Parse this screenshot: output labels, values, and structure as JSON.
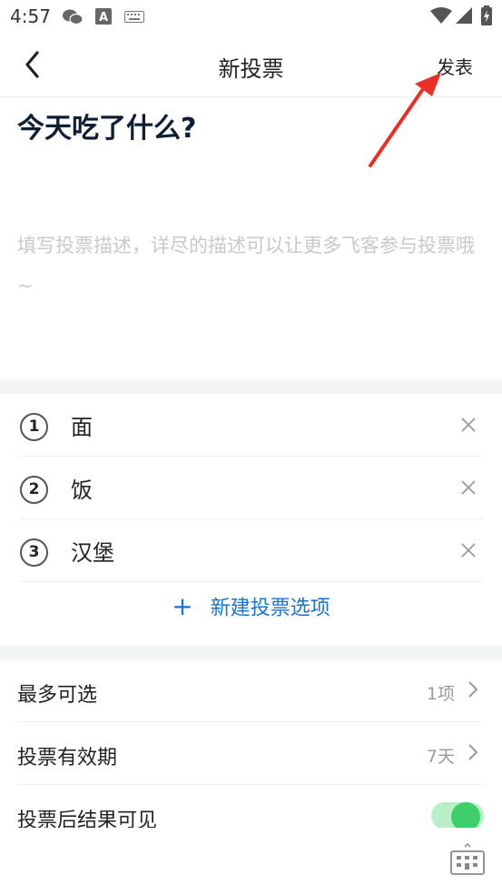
{
  "status_bar": {
    "time": "4:57",
    "icons": [
      "wechat-icon",
      "text-a-icon",
      "keyboard-icon",
      "wifi-icon",
      "signal-icon",
      "battery-icon"
    ]
  },
  "nav": {
    "title": "新投票",
    "publish_label": "发表",
    "back_icon": "chevron-left-icon"
  },
  "vote": {
    "title": "今天吃了什么?",
    "description_placeholder": "填写投票描述，详尽的描述可以让更多飞客参与投票哦~"
  },
  "options": [
    {
      "number": "1",
      "text": "面"
    },
    {
      "number": "2",
      "text": "饭"
    },
    {
      "number": "3",
      "text": "汉堡"
    }
  ],
  "add_option": {
    "icon": "+",
    "label": "新建投票选项"
  },
  "settings": {
    "max_choices": {
      "label": "最多可选",
      "value": "1项"
    },
    "validity": {
      "label": "投票有效期",
      "value": "7天"
    },
    "results_visible": {
      "label": "投票后结果可见",
      "enabled": true
    }
  },
  "colors": {
    "accent": "#1a73c9",
    "toggle_on": "#3ecf6c",
    "annotation_arrow": "#e8302a"
  }
}
